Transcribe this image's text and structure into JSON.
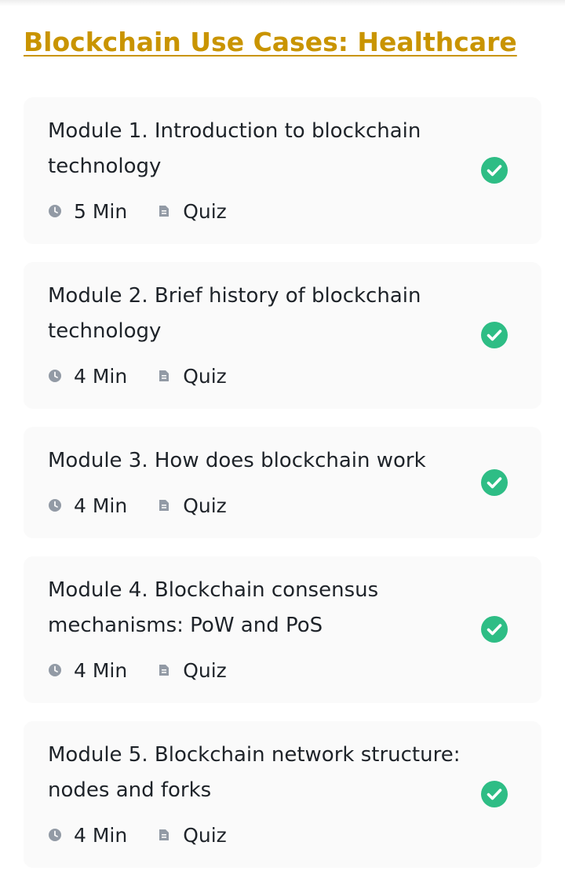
{
  "course": {
    "title": "Blockchain Use Cases: Healthcare"
  },
  "colors": {
    "accent": "#c99400",
    "card_background": "#fafafa",
    "text": "#1e2329",
    "icon_gray": "#929aa5",
    "complete_green": "#2ebd85"
  },
  "modules": [
    {
      "title": "Module 1. Introduction to blockchain technology",
      "duration": "5 Min",
      "type": "Quiz",
      "status_icon": "check-circle-icon",
      "completed": true
    },
    {
      "title": "Module 2. Brief history of blockchain technology",
      "duration": "4 Min",
      "type": "Quiz",
      "status_icon": "check-circle-icon",
      "completed": true
    },
    {
      "title": "Module 3. How does blockchain work",
      "duration": "4 Min",
      "type": "Quiz",
      "status_icon": "check-circle-icon",
      "completed": true
    },
    {
      "title": "Module 4. Blockchain consensus mechanisms: PoW and PoS",
      "duration": "4 Min",
      "type": "Quiz",
      "status_icon": "check-circle-icon",
      "completed": true
    },
    {
      "title": "Module 5. Blockchain network structure: nodes and forks",
      "duration": "4 Min",
      "type": "Quiz",
      "status_icon": "check-circle-icon",
      "completed": true
    }
  ]
}
